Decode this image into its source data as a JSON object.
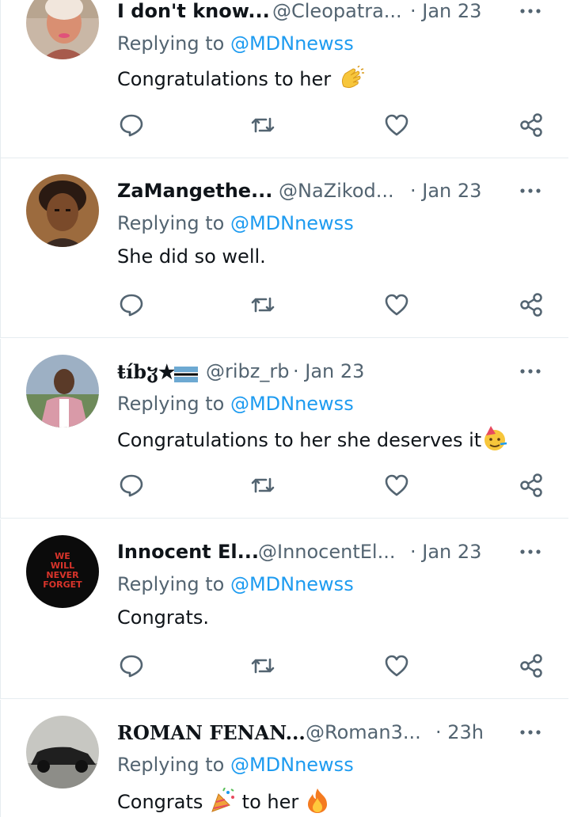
{
  "tweets": [
    {
      "name": "I don't know...",
      "handle": "@Cleopatra...",
      "time": "· Jan 23",
      "replying_prefix": "Replying to ",
      "replying_to": "@MDNnewss",
      "text": "Congratulations to her",
      "emoji": "clapping-hands"
    },
    {
      "name": "ZaMangethe...",
      "handle": "@NaZikod...",
      "time": "· Jan 23",
      "replying_prefix": "Replying to ",
      "replying_to": "@MDNnewss",
      "text": "She did so well."
    },
    {
      "name": "ŧíbჳ★",
      "handle": "@ribz_rb",
      "time": "· Jan 23",
      "replying_prefix": "Replying to ",
      "replying_to": "@MDNnewss",
      "text": "Congratulations to her she deserves it",
      "emoji": "partying-face"
    },
    {
      "name": "Innocent El...",
      "handle": "@InnocentEl...",
      "time": "· Jan 23",
      "replying_prefix": "Replying to ",
      "replying_to": "@MDNnewss",
      "text": "Congrats."
    },
    {
      "name": "ROMAN FENAN...",
      "handle": "@Roman3...",
      "time": "· 23h",
      "replying_prefix": "Replying to ",
      "replying_to": "@MDNnewss",
      "text_a": "Congrats",
      "text_b": "to her",
      "emoji_a": "party-popper",
      "emoji_b": "fire"
    }
  ],
  "avatar_logo_text": [
    "WE",
    "WILL",
    "NEVER",
    "FORGET"
  ],
  "colors": {
    "accent": "#1d9bf0",
    "secondary_text": "#536471",
    "divider": "#e6ecf0"
  },
  "icons": [
    "reply-icon",
    "retweet-icon",
    "like-icon",
    "share-icon",
    "more-icon"
  ]
}
